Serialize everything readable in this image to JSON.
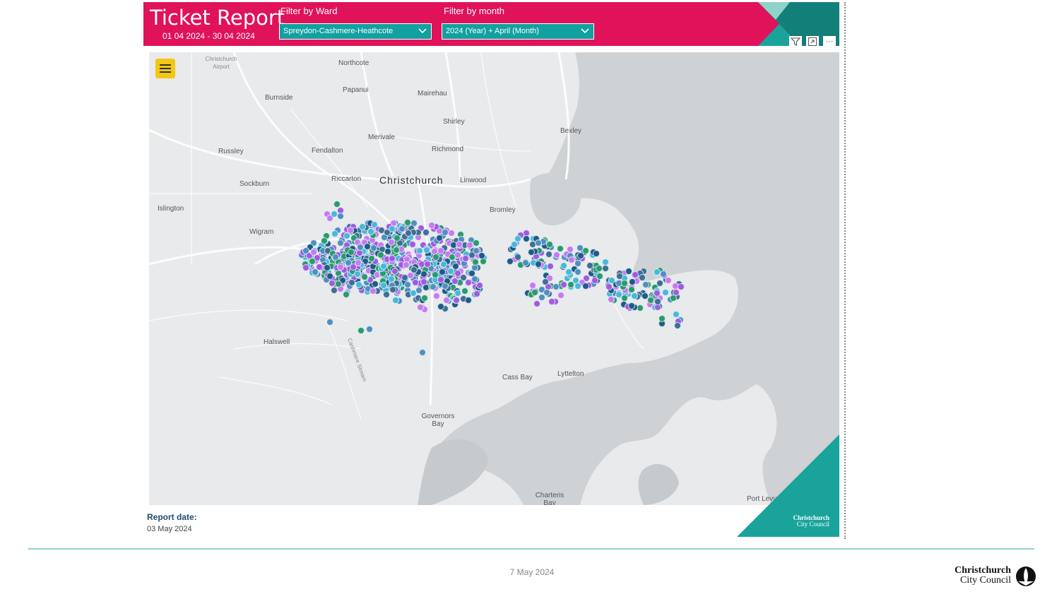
{
  "header": {
    "title": "Ticket Report",
    "date_range": "01 04 2024 - 30 04 2024",
    "ward_filter": {
      "label": "Filter by Ward",
      "value": "Spreydon-Cashmere-Heathcote"
    },
    "month_filter": {
      "label": "Filter by month",
      "value": "2024 (Year) + April (Month)"
    },
    "tools": [
      "filter-icon",
      "focus-mode-icon",
      "more-options-icon"
    ],
    "more_glyph": "···"
  },
  "colors": {
    "header": "#e0125a",
    "dropdown": "#12a0a0",
    "teal": "#1aa39b",
    "dark_teal": "#137f79",
    "water": "#cfd2d4",
    "land": "#e9eaec",
    "menu": "#f2c811",
    "dots": [
      "#4f8fc0",
      "#9d5ce0",
      "#2a9a6e",
      "#1e5b87",
      "#48b8d8",
      "#c47bf0",
      "#3e6f93"
    ]
  },
  "map": {
    "places": [
      {
        "name": "Christchurch Airport",
        "size": "small"
      },
      {
        "name": "Northcote",
        "size": "normal"
      },
      {
        "name": "Papanui",
        "size": "normal"
      },
      {
        "name": "Burnside",
        "size": "normal"
      },
      {
        "name": "Mairehau",
        "size": "normal"
      },
      {
        "name": "Shirley",
        "size": "normal"
      },
      {
        "name": "Merivale",
        "size": "normal"
      },
      {
        "name": "Bexley",
        "size": "normal"
      },
      {
        "name": "Russley",
        "size": "normal"
      },
      {
        "name": "Fendalton",
        "size": "normal"
      },
      {
        "name": "Richmond",
        "size": "normal"
      },
      {
        "name": "Riccarton",
        "size": "normal"
      },
      {
        "name": "Christchurch",
        "size": "big"
      },
      {
        "name": "Linwood",
        "size": "normal"
      },
      {
        "name": "Sockburn",
        "size": "normal"
      },
      {
        "name": "Islington",
        "size": "normal"
      },
      {
        "name": "Bromley",
        "size": "normal"
      },
      {
        "name": "Wigram",
        "size": "normal"
      },
      {
        "name": "Halswell",
        "size": "normal"
      },
      {
        "name": "Cashmere Stream",
        "size": "small"
      },
      {
        "name": "Cass Bay",
        "size": "normal"
      },
      {
        "name": "Lyttelton",
        "size": "normal"
      },
      {
        "name": "Governors Bay",
        "size": "normal"
      },
      {
        "name": "Charteris Bay",
        "size": "normal"
      },
      {
        "name": "Port Levy",
        "size": "normal"
      }
    ]
  },
  "corner_logo": {
    "line1": "Christchurch",
    "line2": "City Council"
  },
  "report_date": {
    "label": "Report date:",
    "value": "03 May 2024"
  },
  "footer": {
    "date": "7 May 2024",
    "logo_line1": "Christchurch",
    "logo_line2": "City Council"
  }
}
